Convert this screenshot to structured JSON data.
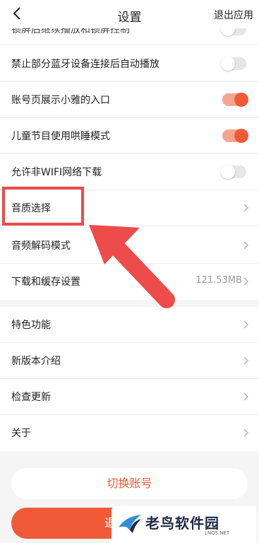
{
  "header": {
    "title": "设置",
    "exit_label": "退出应用"
  },
  "partial_row": {
    "label": "锁屏后继续播放和锁屏控制"
  },
  "toggle_rows": [
    {
      "label": "禁止部分蓝牙设备连接后自动播放",
      "state": "off"
    },
    {
      "label": "账号页展示小雅的入口",
      "state": "on"
    },
    {
      "label": "儿童节目使用哄睡模式",
      "state": "on"
    },
    {
      "label": "允许非WIFI网络下载",
      "state": "off"
    }
  ],
  "nav_rows_1": [
    {
      "label": "音质选择"
    },
    {
      "label": "音频解码模式"
    },
    {
      "label": "下载和缓存设置",
      "value": "121.53MB"
    }
  ],
  "nav_rows_2": [
    {
      "label": "特色功能"
    },
    {
      "label": "新版本介绍"
    },
    {
      "label": "检查更新"
    },
    {
      "label": "关于"
    }
  ],
  "buttons": {
    "switch_account": "切换账号",
    "logout": "退"
  },
  "watermark": {
    "name": "老鸟软件园",
    "site": "LNQS.NET"
  },
  "colors": {
    "accent": "#f15a37",
    "highlight": "#ee4b4b",
    "toggle_on_track": "#f5a58e",
    "gap": "#f5f5f5"
  }
}
